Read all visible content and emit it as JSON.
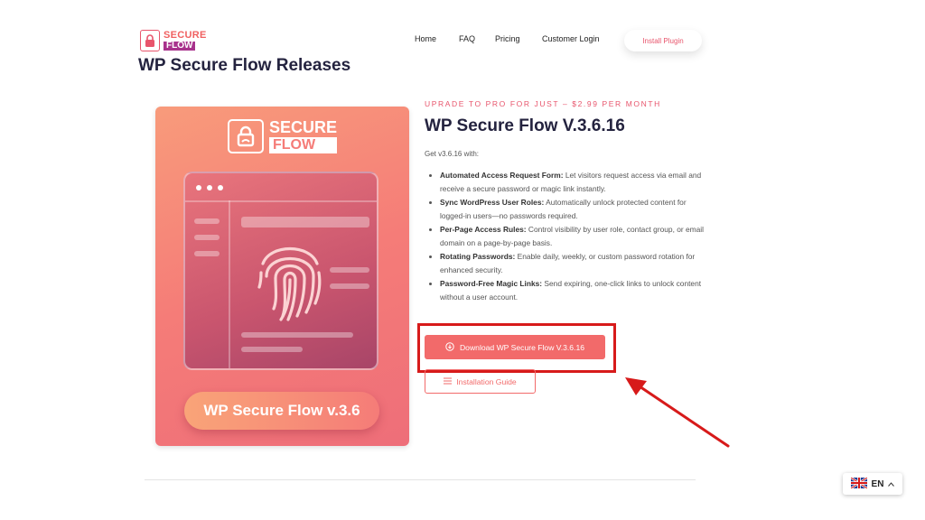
{
  "header": {
    "logo": {
      "line1": "SECURE",
      "line2": "FLOW"
    },
    "nav": [
      "Home",
      "FAQ",
      "Pricing",
      "Customer Login"
    ],
    "install_label": "Install Plugin"
  },
  "page_title": "WP Secure Flow Releases",
  "product_card": {
    "logo": {
      "line1": "SECURE",
      "line2": "FLOW"
    },
    "button_label": "WP Secure Flow v.3.6"
  },
  "release": {
    "upgrade_text": "UPRADE TO PRO FOR JUST – $2.99 PER MONTH",
    "title": "WP Secure Flow V.3.6.16",
    "get_with": "Get v3.6.16 with:",
    "features": [
      {
        "name": "Automated Access Request Form:",
        "desc": " Let visitors request access via email and receive a secure password or magic link instantly."
      },
      {
        "name": "Sync WordPress User Roles:",
        "desc": " Automatically unlock protected content for logged-in users—no passwords required."
      },
      {
        "name": "Per-Page Access Rules:",
        "desc": " Control visibility by user role, contact group, or email domain on a page-by-page basis."
      },
      {
        "name": "Rotating Passwords:",
        "desc": " Enable daily, weekly, or custom password rotation for enhanced security."
      },
      {
        "name": "Password-Free Magic Links:",
        "desc": " Send expiring, one-click links to unlock content without a user account."
      }
    ],
    "download_label": "Download WP Secure Flow V.3.6.16",
    "guide_label": "Installation Guide"
  },
  "language": {
    "code": "EN"
  },
  "colors": {
    "accent": "#f26a6a",
    "title": "#24233f",
    "highlight": "#d71a1a"
  }
}
